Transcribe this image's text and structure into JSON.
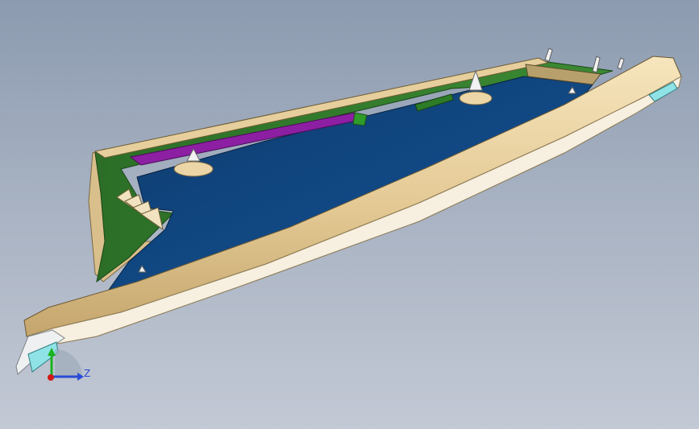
{
  "scene": {
    "model_name": "",
    "colors": {
      "background_top": "#8c9bb0",
      "background_bottom": "#c3c9d5",
      "trim_beige": "#e9d3a2",
      "trim_beige_dark": "#b99e67",
      "inner_panel_blue": "#11427a",
      "frame_green": "#2f7a2a",
      "strip_purple": "#8d1fa3",
      "underside_white": "#eef0f1",
      "lens_cyan": "#8fe3e6"
    },
    "icons": [
      "clip-icon",
      "boss-icon",
      "lens-icon"
    ]
  },
  "triad": {
    "z_label": "Z",
    "axis_colors": {
      "x": "#d21818",
      "y": "#19b31d",
      "z": "#2a4bd6"
    }
  }
}
